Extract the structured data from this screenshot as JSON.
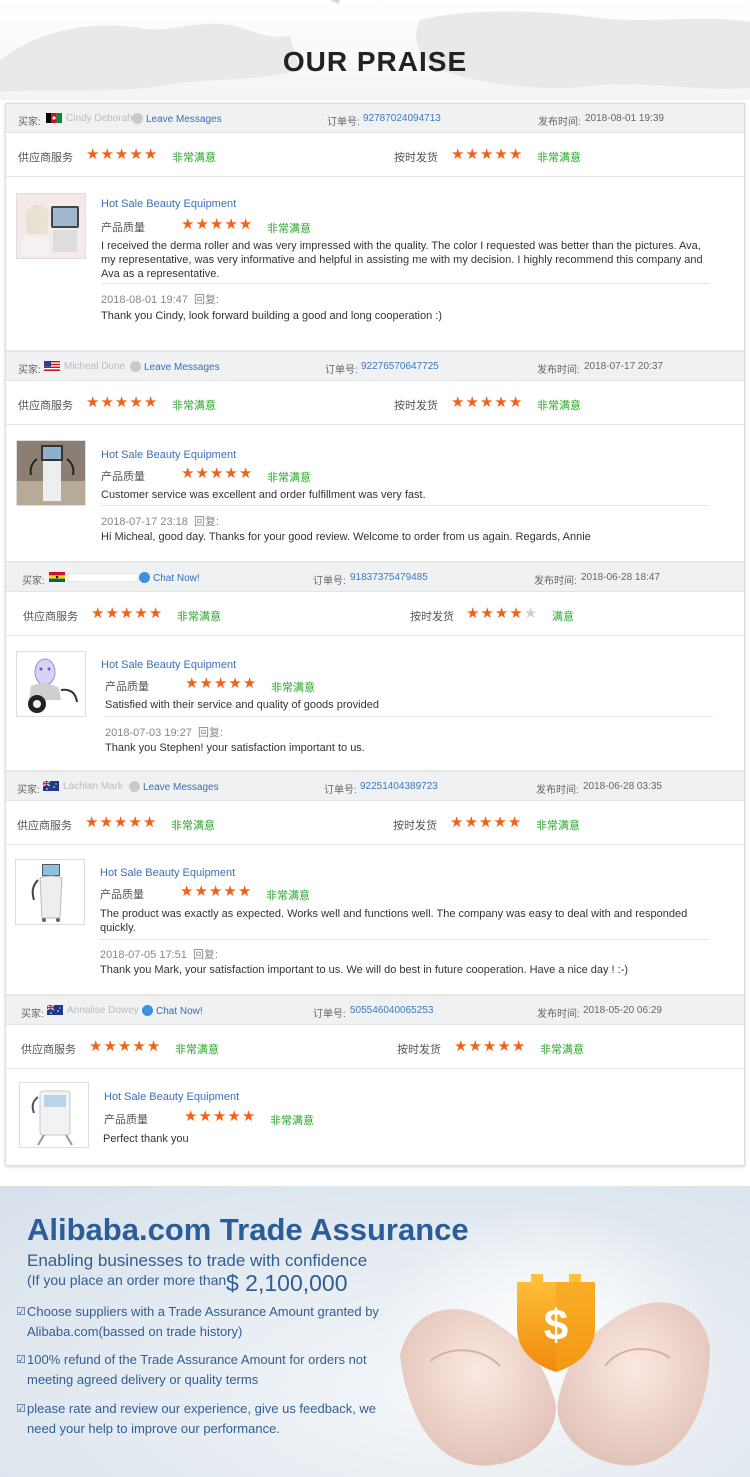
{
  "title": "OUR PRAISE",
  "labels": {
    "buyer": "买家:",
    "order": "订单号:",
    "time": "发布时间:",
    "supplier_service": "供应商服务",
    "on_time": "按时发货",
    "quality": "产品质量",
    "reply": "回复:"
  },
  "reviews": [
    {
      "flag": "afghanistan",
      "buyer_name": "Cindy Deborah",
      "contact": "Leave Messages",
      "order_no": "92787024094713",
      "time": "2018-08-01 19:39",
      "service_stars": 5,
      "service_text": "非常满意",
      "delivery_stars": 5,
      "delivery_text": "非常满意",
      "product": "Hot Sale Beauty Equipment",
      "quality_stars": 5,
      "quality_text": "非常满意",
      "comment": "I received the derma roller and was very impressed with the quality. The color I requested was better than the pictures. Ava, my representative, was very informative and helpful in assisting me with my decision. I highly recommend this company and Ava as a representative.",
      "reply_date": "2018-08-01 19:47",
      "reply_text": "Thank you Cindy, look forward building a good and long cooperation :)"
    },
    {
      "flag": "usa",
      "buyer_name": "Micheal Dune",
      "contact": "Leave Messages",
      "order_no": "92276570647725",
      "time": "2018-07-17 20:37",
      "service_stars": 5,
      "service_text": "非常满意",
      "delivery_stars": 5,
      "delivery_text": "非常满意",
      "product": "Hot Sale Beauty Equipment",
      "quality_stars": 5,
      "quality_text": "非常满意",
      "comment": "Customer service was excellent and order fulfillment was very fast.",
      "reply_date": "2018-07-17 23:18",
      "reply_text": "Hi Micheal, good day. Thanks for your good review. Welcome to order from us again. Regards, Annie"
    },
    {
      "flag": "ghana",
      "buyer_name": "",
      "contact": "Chat Now!",
      "order_no": "91837375479485",
      "time": "2018-06-28 18:47",
      "service_stars": 5,
      "service_text": "非常满意",
      "delivery_stars": 4,
      "delivery_text": "满意",
      "product": "Hot Sale Beauty Equipment",
      "quality_stars": 5,
      "quality_text": "非常满意",
      "comment": "Satisfied with their service and quality of goods provided",
      "reply_date": "2018-07-03 19:27",
      "reply_text": "Thank you Stephen! your satisfaction important to us."
    },
    {
      "flag": "australia",
      "buyer_name": "Lachlan Mark",
      "contact": "Leave Messages",
      "order_no": "92251404389723",
      "time": "2018-06-28 03:35",
      "service_stars": 5,
      "service_text": "非常满意",
      "delivery_stars": 5,
      "delivery_text": "非常满意",
      "product": "Hot Sale Beauty Equipment",
      "quality_stars": 5,
      "quality_text": "非常满意",
      "comment": "The product was exactly as expected. Works well and functions well. The company was easy to deal with and responded quickly.",
      "reply_date": "2018-07-05 17:51",
      "reply_text": "Thank you Mark, your satisfaction important to us. We will do best in future cooperation. Have a nice day ! :-)"
    },
    {
      "flag": "australia",
      "buyer_name": "Annalise Dowey",
      "contact": "Chat Now!",
      "order_no": "505546040065253",
      "time": "2018-05-20 06:29",
      "service_stars": 5,
      "service_text": "非常满意",
      "delivery_stars": 5,
      "delivery_text": "非常满意",
      "product": "Hot Sale Beauty Equipment",
      "quality_stars": 5,
      "quality_text": "非常满意",
      "comment": "Perfect thank you",
      "reply_date": "",
      "reply_text": ""
    }
  ],
  "trade_assurance": {
    "title": "Alibaba.com Trade Assurance",
    "subtitle": "Enabling businesses to trade with confidence",
    "if_text": "(If you place an order more than",
    "amount": "$ 2,100,000",
    "items": [
      "Choose suppliers with a Trade Assurance Amount granted by Alibaba.com(bassed on trade history)",
      "100% refund of the Trade Assurance Amount for orders not meeting agreed delivery or quality terms",
      "please rate and review our experience, give us feedback, we need your help to improve our  performance."
    ],
    "shield_symbol": "$"
  },
  "colors": {
    "star": "#f06218",
    "satisfied": "#2aa52a",
    "link": "#3b6fb6",
    "ta_text": "#2f5f96"
  }
}
